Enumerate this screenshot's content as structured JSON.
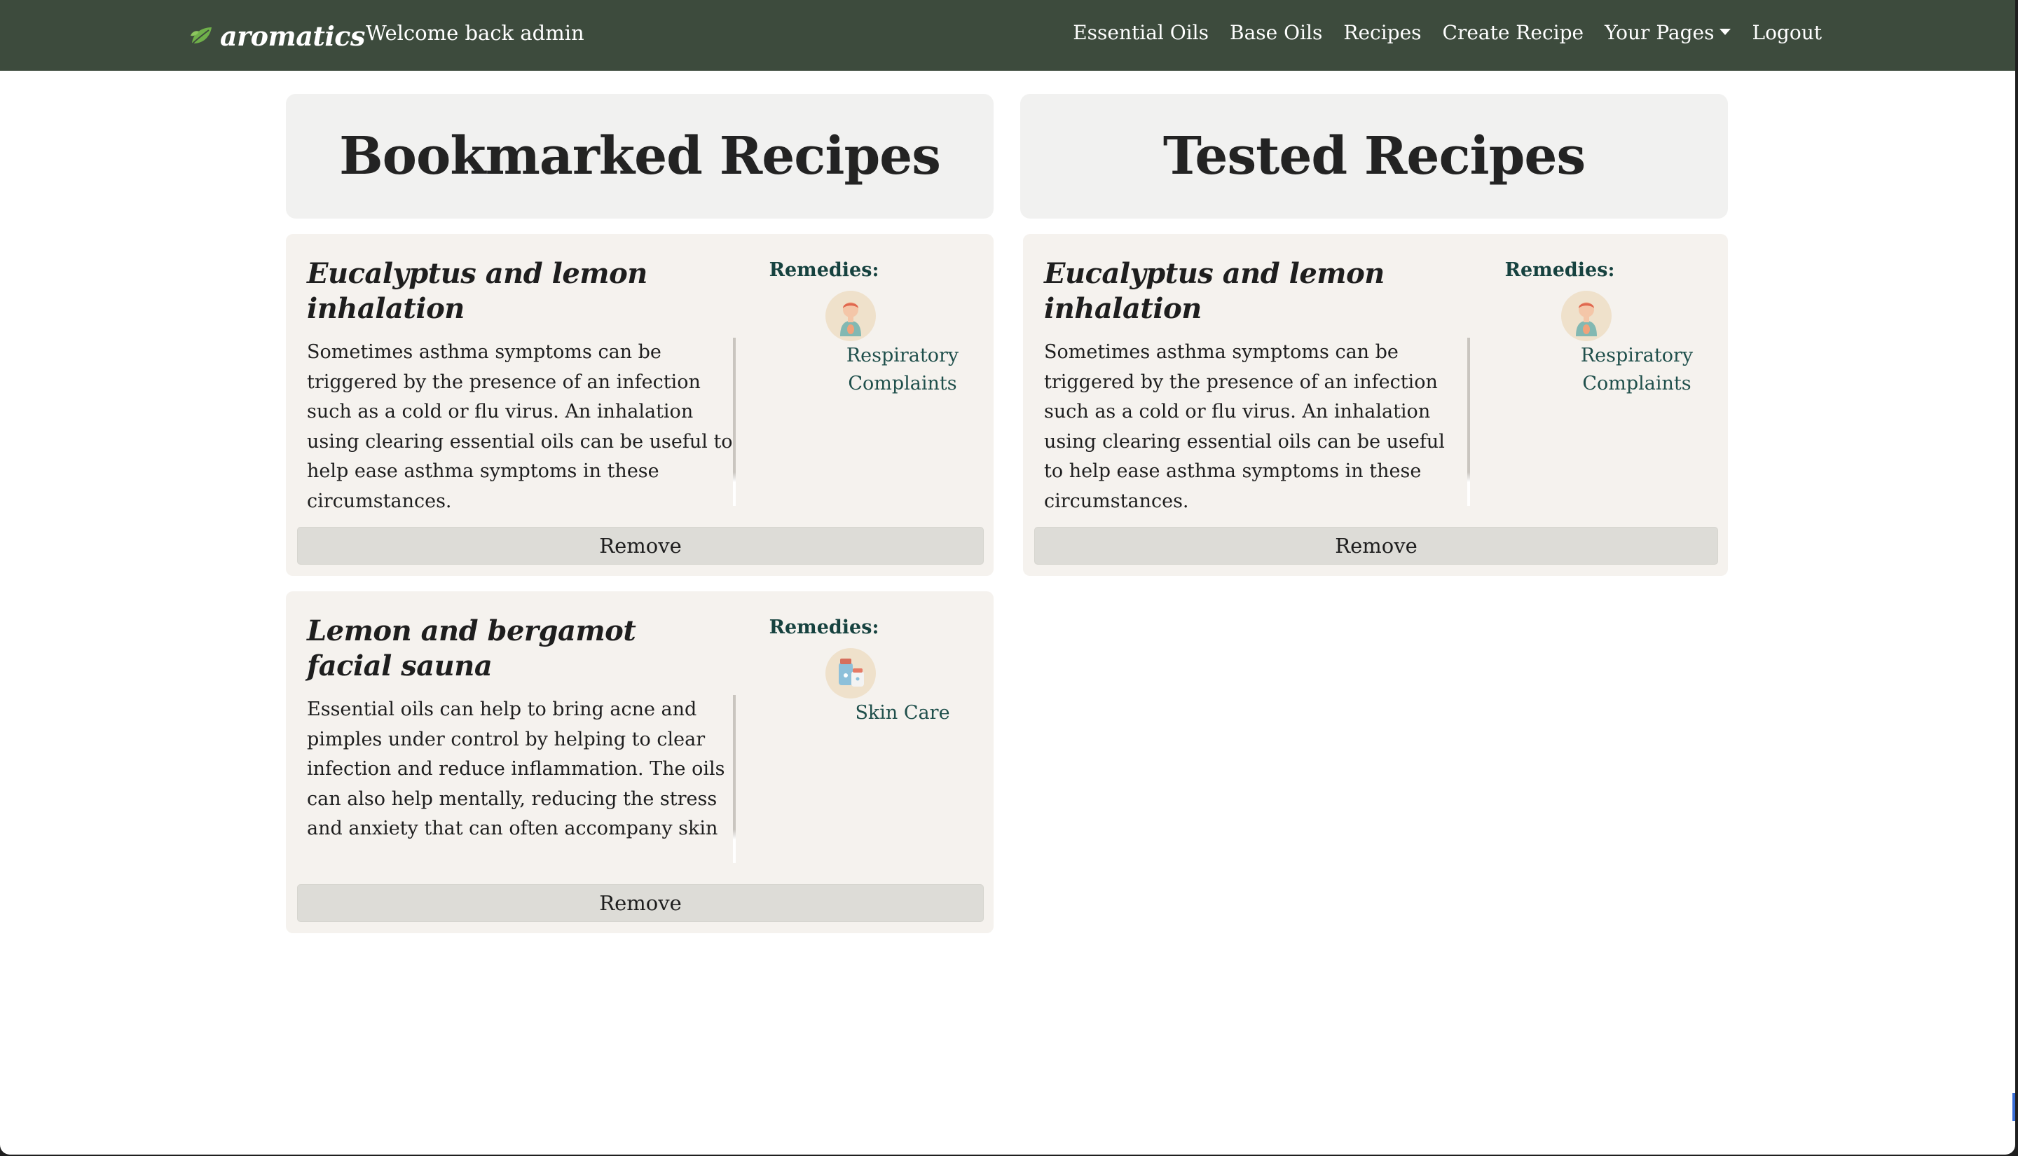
{
  "navbar": {
    "brand": "aromatics",
    "welcome": "Welcome back admin",
    "links": [
      "Essential Oils",
      "Base Oils",
      "Recipes",
      "Create Recipe",
      "Your Pages",
      "Logout"
    ]
  },
  "bookmarked": {
    "heading": "Bookmarked Recipes",
    "cards": [
      {
        "title": "Eucalyptus and lemon inhalation",
        "description": "Sometimes asthma symptoms can be triggered by the presence of an infection such as a cold or flu virus. An inhalation using clearing essential oils can be useful to help ease asthma symptoms in these circumstances.",
        "remedies_label": "Remedies:",
        "remedy": "Respiratory Complaints",
        "remedy_icon": "respiratory-icon",
        "button": "Remove"
      },
      {
        "title": "Lemon and bergamot facial sauna",
        "description": "Essential oils can help to bring acne and pimples under control by helping to clear infection and reduce inflammation. The oils can also help mentally, reducing the stress and anxiety that can often accompany skin",
        "remedies_label": "Remedies:",
        "remedy": "Skin Care",
        "remedy_icon": "skin-care-icon",
        "button": "Remove"
      }
    ]
  },
  "tested": {
    "heading": "Tested Recipes",
    "cards": [
      {
        "title": "Eucalyptus and lemon inhalation",
        "description": "Sometimes asthma symptoms can be triggered by the presence of an infection such as a cold or flu virus. An inhalation using clearing essential oils can be useful to help ease asthma symptoms in these circumstances.",
        "remedies_label": "Remedies:",
        "remedy": "Respiratory Complaints",
        "remedy_icon": "respiratory-icon",
        "button": "Remove"
      }
    ]
  },
  "colors": {
    "navbar": "#3d4b3d",
    "card": "#f5f2ee",
    "section_header": "#f1f1f0",
    "remedy_link": "#1f4f4b",
    "button": "#dddcd7"
  }
}
